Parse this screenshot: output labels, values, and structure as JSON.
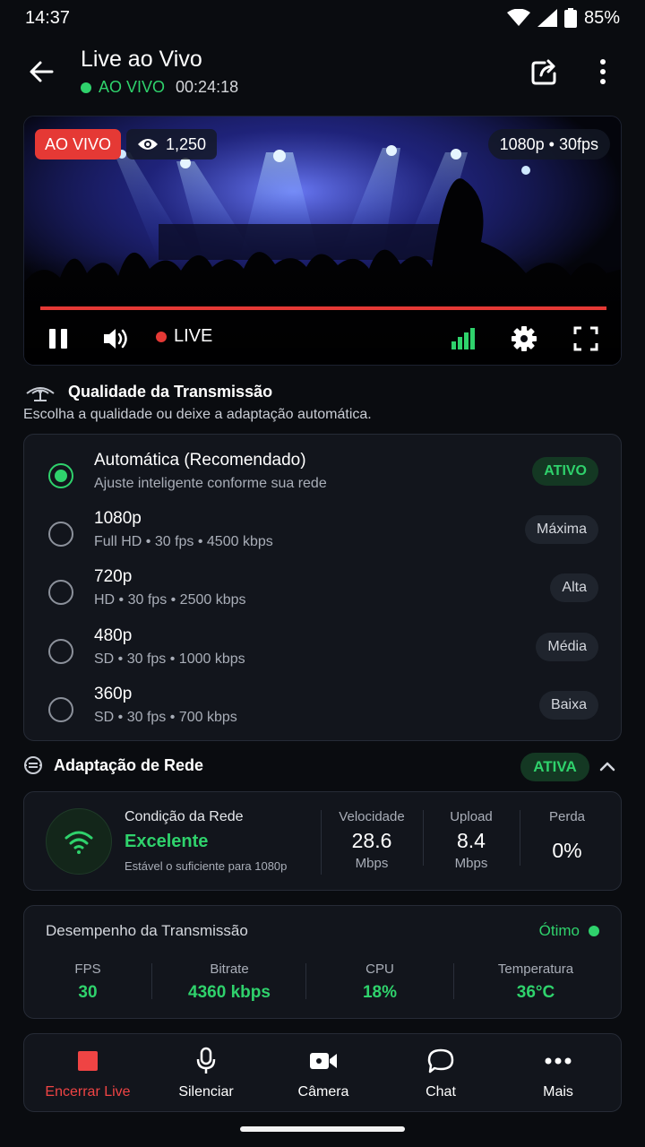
{
  "status_bar": {
    "time": "14:37",
    "battery": "85%"
  },
  "header": {
    "title": "Live ao Vivo",
    "live_label": "AO VIVO",
    "elapsed": "00:24:18",
    "icons": {
      "back": "arrow-left-icon",
      "share": "share-icon",
      "more": "more-vertical-icon"
    }
  },
  "player": {
    "live_badge": "AO VIVO",
    "viewers": "1,250",
    "resolution": "1080p • 30fps",
    "live_indicator": "LIVE",
    "progress": 1.0,
    "colors": {
      "live_red": "#e53935",
      "signal_green": "#2fd26c"
    }
  },
  "quality": {
    "title": "Qualidade da Transmissão",
    "subtitle": "Escolha a qualidade ou deixe a adaptação automática.",
    "options": [
      {
        "title": "Automática (Recomendado)",
        "desc": "Ajuste inteligente conforme sua rede",
        "tag": "ATIVO",
        "selected": true
      },
      {
        "title": "1080p",
        "desc": "Full HD • 30 fps • 4500 kbps",
        "tag": "Máxima",
        "selected": false
      },
      {
        "title": "720p",
        "desc": "HD • 30 fps • 2500 kbps",
        "tag": "Alta",
        "selected": false
      },
      {
        "title": "480p",
        "desc": "SD • 30 fps • 1000 kbps",
        "tag": "Média",
        "selected": false
      },
      {
        "title": "360p",
        "desc": "SD • 30 fps • 700 kbps",
        "tag": "Baixa",
        "selected": false
      }
    ]
  },
  "adaptation": {
    "title": "Adaptação de Rede",
    "badge": "ATIVA",
    "network": {
      "label": "Condição da Rede",
      "status": "Excelente",
      "note": "Estável o suficiente para 1080p"
    },
    "stats": {
      "speed": {
        "label": "Velocidade",
        "value": "28.6",
        "unit": "Mbps"
      },
      "upload": {
        "label": "Upload",
        "value": "8.4",
        "unit": "Mbps"
      },
      "loss": {
        "label": "Perda",
        "value": "0%"
      }
    }
  },
  "performance": {
    "title": "Desempenho da Transmissão",
    "status": "Ótimo",
    "fps": {
      "label": "FPS",
      "value": "30"
    },
    "bitrate": {
      "label": "Bitrate",
      "value": "4360 kbps"
    },
    "cpu": {
      "label": "CPU",
      "value": "18%"
    },
    "temp": {
      "label": "Temperatura",
      "value": "36°C"
    }
  },
  "bottom_bar": {
    "end": "Encerrar Live",
    "mute": "Silenciar",
    "camera": "Câmera",
    "chat": "Chat",
    "more": "Mais"
  }
}
